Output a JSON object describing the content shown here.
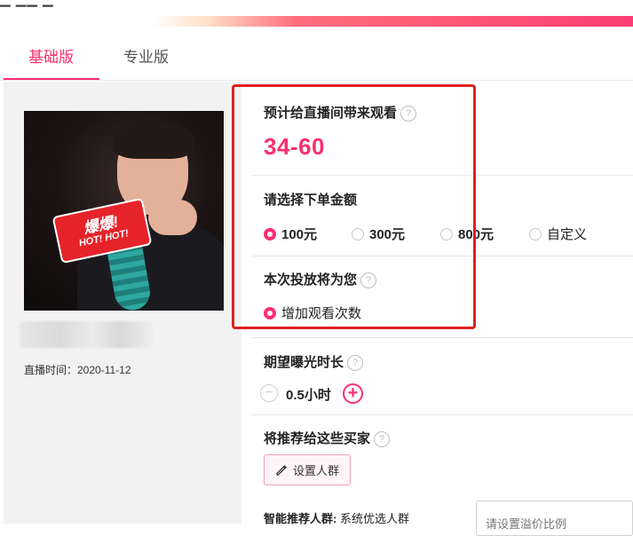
{
  "tabs": [
    {
      "label": "基础版",
      "active": true
    },
    {
      "label": "专业版",
      "active": false
    }
  ],
  "room": {
    "thumbnail_sticker_main": "爆爆!",
    "thumbnail_sticker_sub": "HOT! HOT!",
    "live_time": "直播时间：2020-11-12"
  },
  "estimate": {
    "title": "预计给直播间带来观看",
    "value": "34-60"
  },
  "amount": {
    "title": "请选择下单金额",
    "options": [
      {
        "label": "100元",
        "selected": true
      },
      {
        "label": "300元",
        "selected": false
      },
      {
        "label": "800元",
        "selected": false
      },
      {
        "label": "自定义",
        "selected": false
      }
    ]
  },
  "goal": {
    "title": "本次投放将为您",
    "option": "增加观看次数"
  },
  "duration": {
    "title": "期望曝光时长",
    "value": "0.5小时"
  },
  "audience": {
    "title": "将推荐给这些买家",
    "button_label": "设置人群",
    "smart_label": "智能推荐人群:",
    "smart_value": "系统优选人群",
    "ratio_placeholder": "请设置溢价比例"
  },
  "help_glyph": "?",
  "colors": {
    "accent": "#fb2f6e",
    "highlight_box": "#e02020"
  }
}
